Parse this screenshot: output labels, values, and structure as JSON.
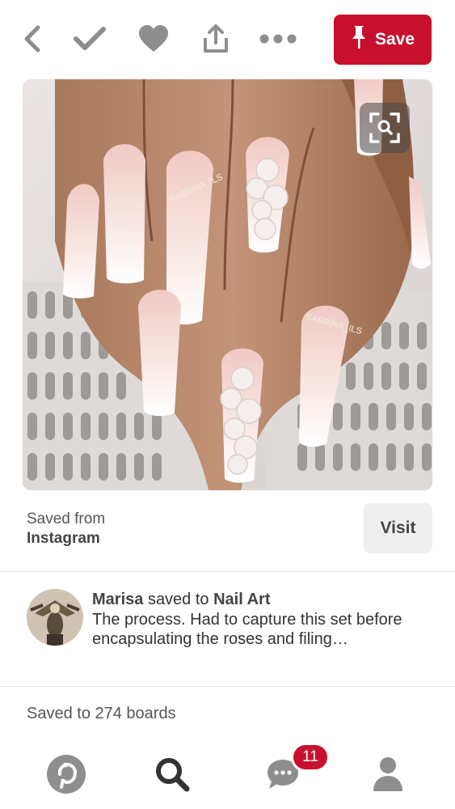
{
  "toolbar": {
    "back_icon": "chevron-left-icon",
    "done_icon": "check-icon",
    "like_icon": "heart-icon",
    "share_icon": "share-icon",
    "more_icon": "more-dots-icon",
    "save_label": "Save"
  },
  "pin": {
    "image_description_icon": "nail-photo",
    "watermark_1": "SABRINA_ILS",
    "watermark_2": "SABRINA_ILS",
    "visual_search_icon": "visual-search-icon"
  },
  "source": {
    "saved_from_label": "Saved from",
    "source_name": "Instagram",
    "visit_label": "Visit"
  },
  "activity": {
    "user_name": "Marisa",
    "saved_to_text": "saved to",
    "board_name": "Nail Art",
    "description": "The process. Had to capture this set before encapsulating the roses and filing…"
  },
  "stats": {
    "saved_count_text": "Saved to 274 boards"
  },
  "bottom_nav": {
    "home_icon": "pinterest-logo-icon",
    "search_icon": "search-icon",
    "messages_icon": "chat-bubble-icon",
    "notification_count": "11",
    "profile_icon": "person-icon"
  },
  "colors": {
    "brand_red": "#c8102e",
    "icon_gray": "#8e8e8e"
  }
}
